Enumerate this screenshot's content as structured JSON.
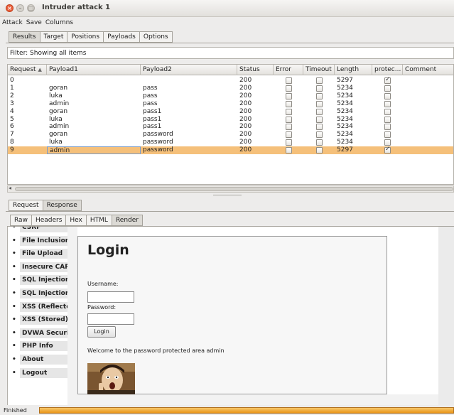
{
  "window": {
    "title": "Intruder attack 1"
  },
  "menu": [
    "Attack",
    "Save",
    "Columns"
  ],
  "tabs": [
    "Results",
    "Target",
    "Positions",
    "Payloads",
    "Options"
  ],
  "filter": {
    "text": "Filter: Showing all items"
  },
  "table": {
    "headers": [
      "Request",
      "Payload1",
      "Payload2",
      "Status",
      "Error",
      "Timeout",
      "Length",
      "protec...",
      "Comment"
    ],
    "sort_indicator": "▲",
    "rows": [
      {
        "request": "0",
        "payload1": "",
        "payload2": "",
        "status": "200",
        "error": false,
        "timeout": false,
        "length": "5297",
        "protected": true
      },
      {
        "request": "1",
        "payload1": "goran",
        "payload2": "pass",
        "status": "200",
        "error": false,
        "timeout": false,
        "length": "5234",
        "protected": false
      },
      {
        "request": "2",
        "payload1": "luka",
        "payload2": "pass",
        "status": "200",
        "error": false,
        "timeout": false,
        "length": "5234",
        "protected": false
      },
      {
        "request": "3",
        "payload1": "admin",
        "payload2": "pass",
        "status": "200",
        "error": false,
        "timeout": false,
        "length": "5234",
        "protected": false
      },
      {
        "request": "4",
        "payload1": "goran",
        "payload2": "pass1",
        "status": "200",
        "error": false,
        "timeout": false,
        "length": "5234",
        "protected": false
      },
      {
        "request": "5",
        "payload1": "luka",
        "payload2": "pass1",
        "status": "200",
        "error": false,
        "timeout": false,
        "length": "5234",
        "protected": false
      },
      {
        "request": "6",
        "payload1": "admin",
        "payload2": "pass1",
        "status": "200",
        "error": false,
        "timeout": false,
        "length": "5234",
        "protected": false
      },
      {
        "request": "7",
        "payload1": "goran",
        "payload2": "password",
        "status": "200",
        "error": false,
        "timeout": false,
        "length": "5234",
        "protected": false
      },
      {
        "request": "8",
        "payload1": "luka",
        "payload2": "password",
        "status": "200",
        "error": false,
        "timeout": false,
        "length": "5234",
        "protected": false
      },
      {
        "request": "9",
        "payload1": "admin",
        "payload2": "password",
        "status": "200",
        "error": false,
        "timeout": false,
        "length": "5297",
        "protected": true,
        "selected": true
      }
    ]
  },
  "subtabs": [
    "Request",
    "Response"
  ],
  "response_tabs": [
    "Raw",
    "Headers",
    "Hex",
    "HTML",
    "Render"
  ],
  "render": {
    "nav": [
      "CSRF",
      "File Inclusion",
      "File Upload",
      "Insecure CAPTCHA",
      "SQL Injection",
      "SQL Injection (Blind)",
      "XSS (Reflected)",
      "XSS (Stored)",
      "DVWA Security",
      "PHP Info",
      "About",
      "Logout"
    ],
    "login_title": "Login",
    "username_label": "Username:",
    "password_label": "Password:",
    "login_button": "Login",
    "welcome": "Welcome to the password protected area admin"
  },
  "status": {
    "text": "Finished",
    "progress": 1.0
  },
  "colors": {
    "selected_row": "#f5c07a",
    "progress": "#e99619",
    "close_button": "#e95f3c"
  }
}
